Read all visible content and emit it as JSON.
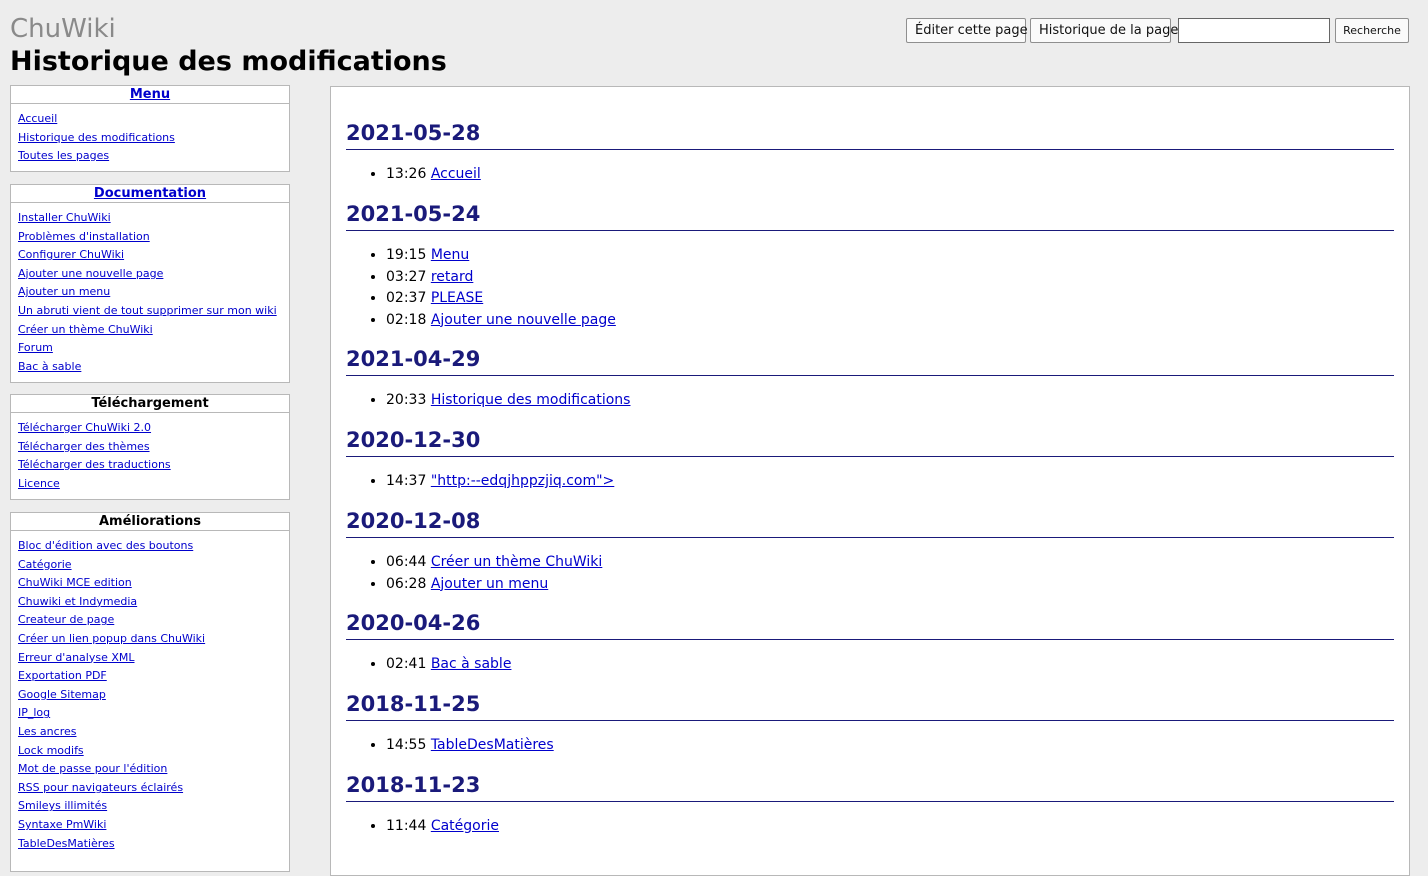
{
  "header": {
    "site_title": "ChuWiki",
    "page_title": "Historique des modifications"
  },
  "toolbar": {
    "edit_label": "Éditer cette page",
    "history_label": "Historique de la page",
    "search_value": "",
    "search_label": "Recherche"
  },
  "sidebar": {
    "menu": {
      "title": "Menu",
      "items": [
        "Accueil",
        "Historique des modifications",
        "Toutes les pages"
      ]
    },
    "documentation": {
      "title": "Documentation",
      "items": [
        "Installer ChuWiki",
        "Problèmes d'installation",
        "Configurer ChuWiki",
        "Ajouter une nouvelle page",
        "Ajouter un menu",
        "Un abruti vient de tout supprimer sur mon wiki",
        "Créer un thème ChuWiki",
        "Forum",
        "Bac à sable"
      ]
    },
    "telechargement": {
      "title": "Téléchargement",
      "items": [
        "Télécharger ChuWiki 2.0",
        "Télécharger des thèmes",
        "Télécharger des traductions",
        "Licence"
      ]
    },
    "ameliorations": {
      "title": "Améliorations",
      "items": [
        "Bloc d'édition avec des boutons",
        "Catégorie",
        "ChuWiki MCE edition",
        "Chuwiki et Indymedia",
        "Createur de page",
        "Créer un lien popup dans ChuWiki",
        "Erreur d'analyse XML",
        "Exportation PDF",
        "Google Sitemap",
        "IP_log",
        "Les ancres",
        "Lock modifs",
        "Mot de passe pour l'édition",
        "RSS pour navigateurs éclairés",
        "Smileys illimités",
        "Syntaxe PmWiki",
        "TableDesMatières"
      ]
    }
  },
  "history": [
    {
      "date": "2021-05-28",
      "entries": [
        {
          "time": "13:26",
          "page": "Accueil"
        }
      ]
    },
    {
      "date": "2021-05-24",
      "entries": [
        {
          "time": "19:15",
          "page": "Menu"
        },
        {
          "time": "03:27",
          "page": "retard"
        },
        {
          "time": "02:37",
          "page": "PLEASE"
        },
        {
          "time": "02:18",
          "page": "Ajouter une nouvelle page"
        }
      ]
    },
    {
      "date": "2021-04-29",
      "entries": [
        {
          "time": "20:33",
          "page": "Historique des modifications"
        }
      ]
    },
    {
      "date": "2020-12-30",
      "entries": [
        {
          "time": "14:37",
          "page": "\"http:--edqjhppzjiq.com\">"
        }
      ]
    },
    {
      "date": "2020-12-08",
      "entries": [
        {
          "time": "06:44",
          "page": "Créer un thème ChuWiki"
        },
        {
          "time": "06:28",
          "page": "Ajouter un menu"
        }
      ]
    },
    {
      "date": "2020-04-26",
      "entries": [
        {
          "time": "02:41",
          "page": "Bac à sable"
        }
      ]
    },
    {
      "date": "2018-11-25",
      "entries": [
        {
          "time": "14:55",
          "page": "TableDesMatières"
        }
      ]
    },
    {
      "date": "2018-11-23",
      "entries": [
        {
          "time": "11:44",
          "page": "Catégorie"
        }
      ]
    }
  ]
}
